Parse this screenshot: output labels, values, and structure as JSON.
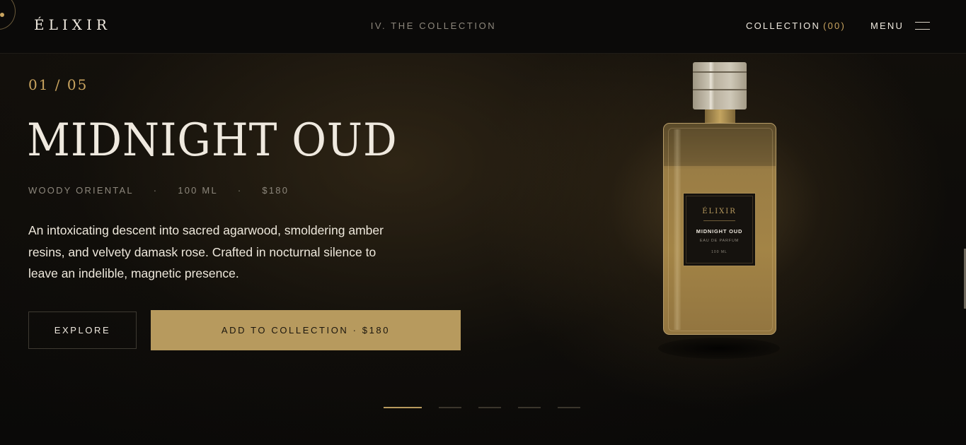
{
  "header": {
    "logo": "ÉLIXIR",
    "chapter": "IV. THE COLLECTION",
    "collection_label": "COLLECTION",
    "collection_count": "(00)",
    "menu_label": "MENU"
  },
  "hero": {
    "counter": "01 / 05",
    "title": "MIDNIGHT OUD",
    "meta": [
      "WOODY ORIENTAL",
      "100 ML",
      "$180"
    ],
    "meta_separator": "·",
    "description": "An intoxicating descent into sacred agarwood, smoldering amber resins, and velvety damask rose. Crafted in nocturnal silence to leave an indelible, magnetic presence.",
    "explore_label": "EXPLORE",
    "add_label": "ADD TO COLLECTION · $180"
  },
  "bottle_label": {
    "brand": "ÉLIXIR",
    "name": "MIDNIGHT OUD",
    "type": "EAU DE PARFUM",
    "volume": "100 ML"
  },
  "pagination": {
    "total": 5,
    "active_index": 0
  },
  "colors": {
    "accent_gold": "#b79a5e",
    "gold_text": "#c9a45f",
    "background": "#0b0a08",
    "text": "#efe9df",
    "muted": "#8d877c"
  }
}
